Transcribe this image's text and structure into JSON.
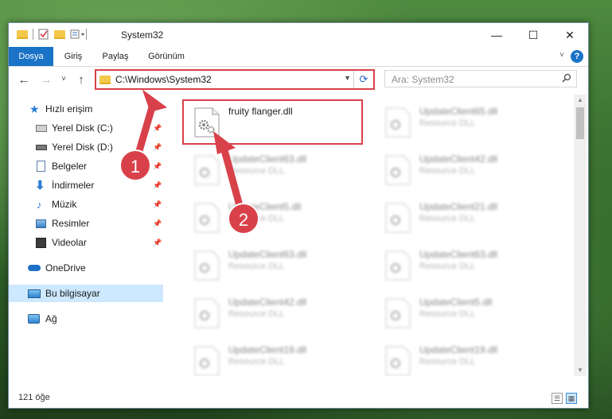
{
  "window": {
    "title": "System32",
    "controls": {
      "minimize": "—",
      "maximize": "☐",
      "close": "✕"
    }
  },
  "ribbon": {
    "tabs": [
      "Dosya",
      "Giriş",
      "Paylaş",
      "Görünüm"
    ],
    "help": "?"
  },
  "navbar": {
    "back": "←",
    "forward": "→",
    "recent": "˅",
    "up": "↑",
    "address": "C:\\Windows\\System32",
    "search_placeholder": "Ara: System32"
  },
  "sidebar": {
    "items": [
      {
        "label": "Hızlı erişim",
        "icon": "star-icon"
      },
      {
        "label": "Yerel Disk (C:)",
        "icon": "drive-icon",
        "pinned": true
      },
      {
        "label": "Yerel Disk (D:)",
        "icon": "drive-icon",
        "pinned": true
      },
      {
        "label": "Belgeler",
        "icon": "documents-icon",
        "pinned": true
      },
      {
        "label": "İndirmeler",
        "icon": "download-icon",
        "pinned": true
      },
      {
        "label": "Müzik",
        "icon": "music-icon",
        "pinned": true
      },
      {
        "label": "Resimler",
        "icon": "pictures-icon",
        "pinned": true
      },
      {
        "label": "Videolar",
        "icon": "video-icon",
        "pinned": true
      },
      {
        "label": "OneDrive",
        "icon": "cloud-icon"
      },
      {
        "label": "Bu bilgisayar",
        "icon": "computer-icon",
        "selected": true
      },
      {
        "label": "Ağ",
        "icon": "network-icon"
      }
    ]
  },
  "files": {
    "featured": {
      "name": "fruity flanger.dll"
    },
    "left": [
      {
        "name": "UpdateClient63.dll",
        "type": "Resource DLL"
      },
      {
        "name": "UpdateClient5.dll",
        "type": "Resource DLL"
      },
      {
        "name": "UpdateClient63.dll",
        "type": "Resource DLL"
      },
      {
        "name": "UpdateClient42.dll",
        "type": "Resource DLL"
      },
      {
        "name": "UpdateClient19.dll",
        "type": "Resource DLL"
      }
    ],
    "right": [
      {
        "name": "UpdateClient65.dll",
        "type": "Resource DLL"
      },
      {
        "name": "UpdateClient42.dll",
        "type": "Resource DLL"
      },
      {
        "name": "UpdateClient21.dll",
        "type": "Resource DLL"
      },
      {
        "name": "UpdateClient63.dll",
        "type": "Resource DLL"
      },
      {
        "name": "UpdateClient5.dll",
        "type": "Resource DLL"
      },
      {
        "name": "UpdateClient19.dll",
        "type": "Resource DLL"
      }
    ]
  },
  "status": {
    "count": "121 öğe"
  },
  "annotations": {
    "step1": "1",
    "step2": "2",
    "color": "#d9414a"
  }
}
